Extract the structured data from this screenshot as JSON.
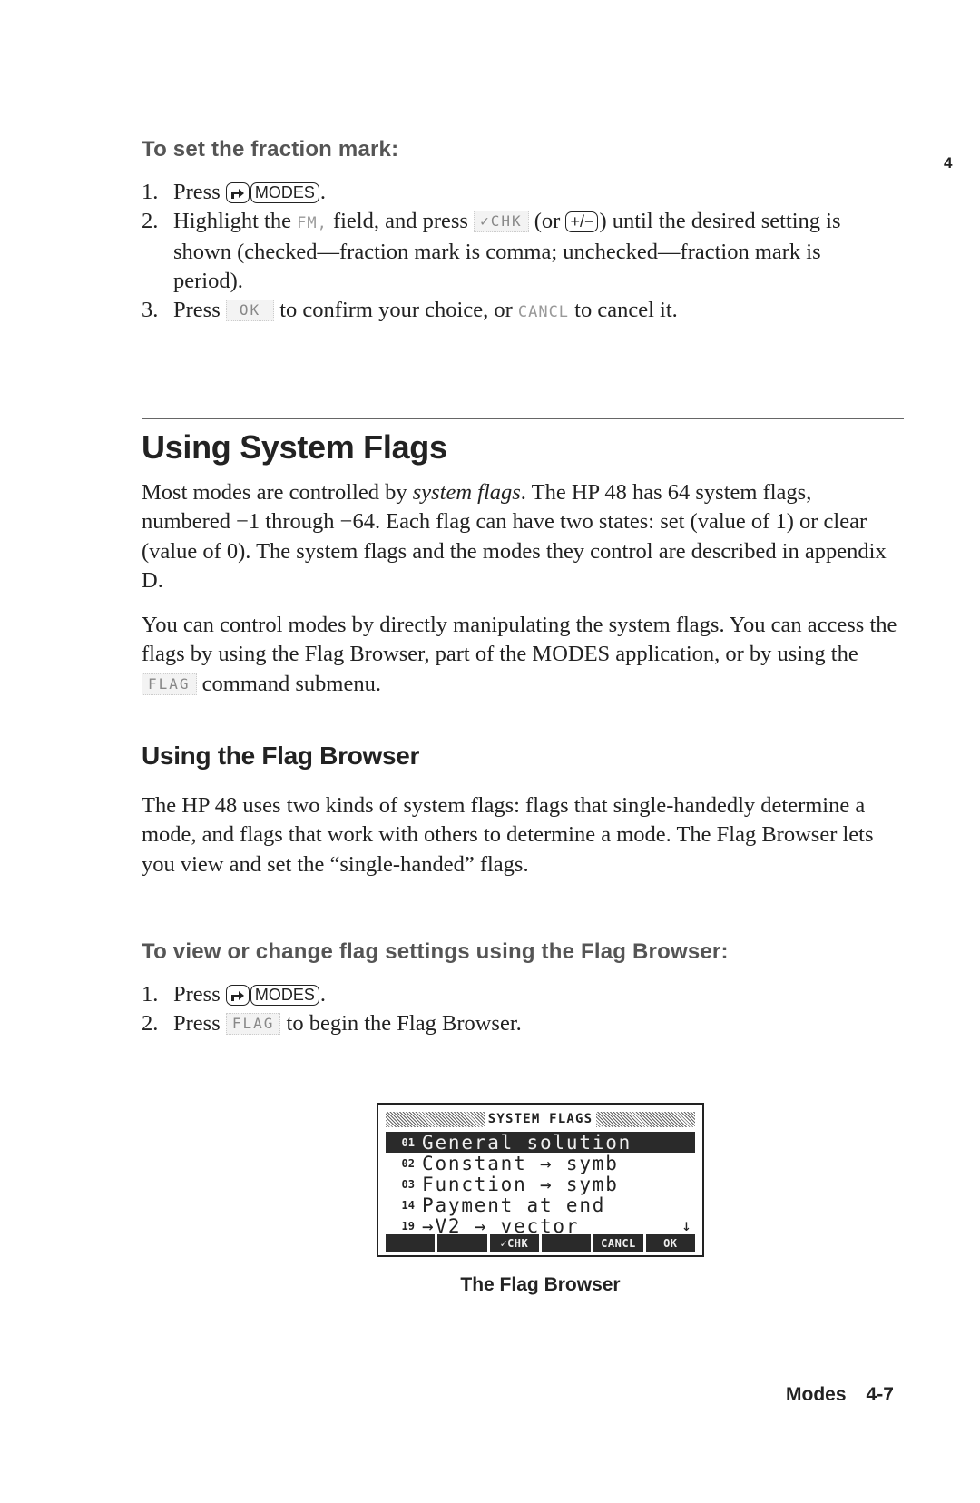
{
  "chapter_tab": "4",
  "fraction_mark_procedure": {
    "heading": "To set the fraction mark:",
    "steps": [
      {
        "num": "1.",
        "prefix": "Press ",
        "keys": [
          "shift-right",
          "MODES"
        ],
        "suffix": "."
      },
      {
        "num": "2.",
        "t1": "Highlight the ",
        "field": "FM,",
        "t2": " field, and press ",
        "softkey": "✓CHK",
        "t3": " (or ",
        "key": "+/−",
        "t4": ") until the desired setting is shown (checked—fraction mark is comma; unchecked—fraction mark is period)."
      },
      {
        "num": "3.",
        "t1": "Press ",
        "softkey_ok": "OK",
        "t2": " to confirm your choice, or ",
        "softkey_cancel": "CANCL",
        "t3": " to cancel it."
      }
    ]
  },
  "section": {
    "title": "Using System Flags",
    "para1": {
      "t1": "Most modes are controlled by ",
      "em": "system flags",
      "t2": ". The HP 48 has 64 system flags, numbered −1 through −64. Each flag can have two states: set (value of 1) or clear (value of 0). The system flags and the modes they control are described in appendix D."
    },
    "para2": {
      "t1": "You can control modes by directly manipulating the system flags. You can access the flags by using the Flag Browser, part of the MODES application, or by using the ",
      "softkey": "FLAG",
      "t2": " command submenu."
    }
  },
  "subsection": {
    "title": "Using the Flag Browser",
    "para": "The HP 48 uses two kinds of system flags: flags that single-handedly determine a mode, and flags that work with others to determine a mode. The Flag Browser lets you view and set the “single-handed” flags."
  },
  "flag_browser_procedure": {
    "heading": "To view or change flag settings using the Flag Browser:",
    "steps": [
      {
        "num": "1.",
        "prefix": "Press ",
        "keys": [
          "shift-right",
          "MODES"
        ],
        "suffix": "."
      },
      {
        "num": "2.",
        "t1": "Press ",
        "softkey": "FLAG",
        "t2": " to begin the Flag Browser."
      }
    ]
  },
  "calculator_screen": {
    "title": "SYSTEM FLAGS",
    "rows": [
      {
        "num": "01",
        "label": "General solution",
        "selected": true
      },
      {
        "num": "02",
        "label": "Constant → symb",
        "selected": false
      },
      {
        "num": "03",
        "label": "Function → symb",
        "selected": false
      },
      {
        "num": "14",
        "label": "Payment at end",
        "selected": false
      },
      {
        "num": "19",
        "label": "→V2 → vector",
        "selected": false
      }
    ],
    "scroll_indicator": "↓",
    "menu": [
      "",
      "",
      "✓CHK",
      "",
      "CANCL",
      "OK"
    ]
  },
  "figure_caption": "The Flag Browser",
  "footer": {
    "chapter": "Modes",
    "page": "4-7"
  }
}
